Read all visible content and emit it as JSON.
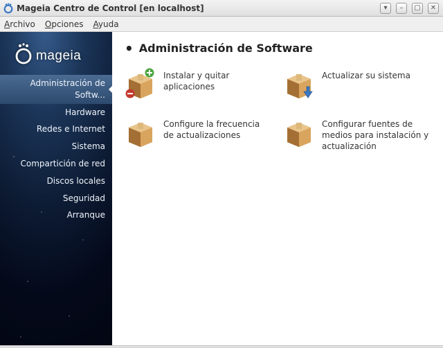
{
  "window": {
    "title": "Mageia Centro de Control  [en localhost]"
  },
  "menu": {
    "items": [
      "Archivo",
      "Opciones",
      "Ayuda"
    ]
  },
  "brand": {
    "name": "mageia"
  },
  "sidebar": {
    "items": [
      {
        "label": "Administración de Softw...",
        "selected": true
      },
      {
        "label": "Hardware"
      },
      {
        "label": "Redes e Internet"
      },
      {
        "label": "Sistema"
      },
      {
        "label": "Compartición de red"
      },
      {
        "label": "Discos locales"
      },
      {
        "label": "Seguridad"
      },
      {
        "label": "Arranque"
      }
    ]
  },
  "section": {
    "title": "Administración de Software",
    "items": [
      {
        "icon": "box-addremove",
        "label": "Instalar y quitar aplicaciones"
      },
      {
        "icon": "box-update",
        "label": "Actualizar su sistema"
      },
      {
        "icon": "box-plain",
        "label": "Configure la frecuencia de actualizaciones"
      },
      {
        "icon": "box-plain",
        "label": "Configurar fuentes de medios para instalación y actualización"
      }
    ]
  }
}
